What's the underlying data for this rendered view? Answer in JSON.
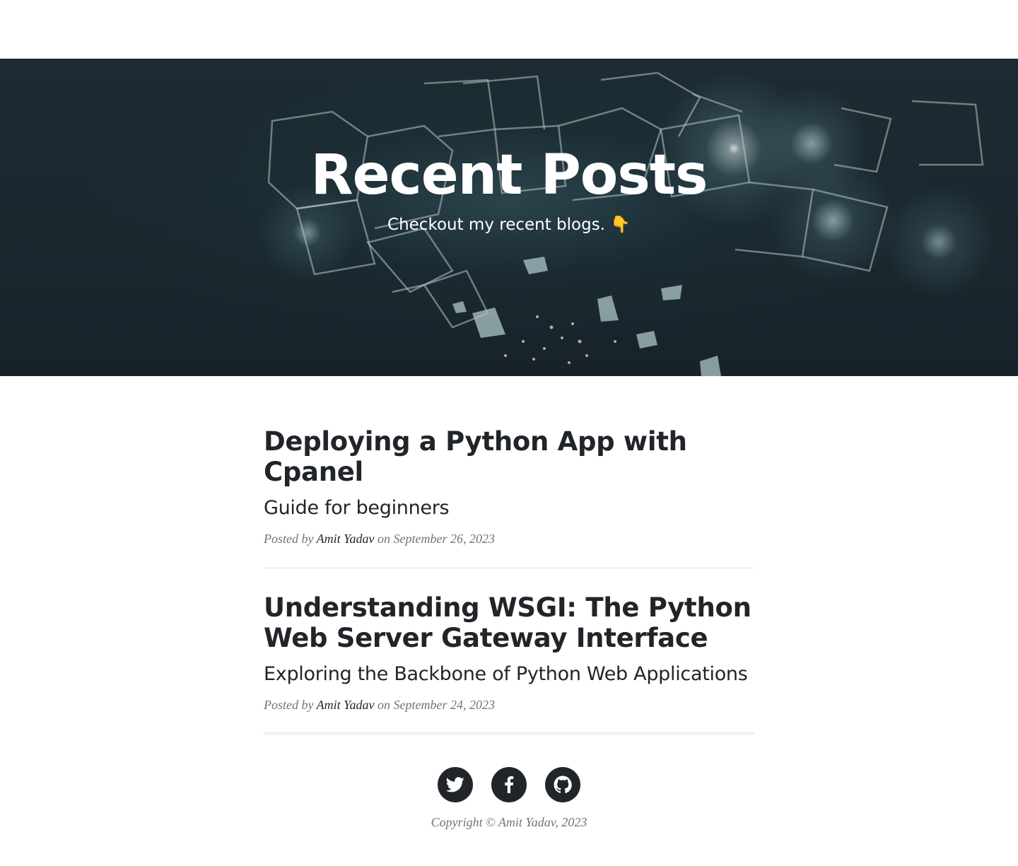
{
  "hero": {
    "title": "Recent Posts",
    "subtitle": "Checkout my recent blogs. 👇"
  },
  "posts": [
    {
      "title": "Deploying a Python App with Cpanel",
      "subtitle": "Guide for beginners",
      "posted_by": "Posted by",
      "author": "Amit Yadav",
      "date": "on September 26, 2023"
    },
    {
      "title": "Understanding WSGI: The Python Web Server Gateway Interface",
      "subtitle": "Exploring the Backbone of Python Web Applications",
      "posted_by": "Posted by",
      "author": "Amit Yadav",
      "date": "on September 24, 2023"
    }
  ],
  "footer": {
    "social": [
      {
        "icon": "twitter-icon"
      },
      {
        "icon": "facebook-icon"
      },
      {
        "icon": "github-icon"
      }
    ],
    "copyright": "Copyright © Amit Yadav, 2023"
  },
  "colors": {
    "text": "#212529",
    "muted": "#6c757d",
    "rule": "#dee2e6"
  }
}
